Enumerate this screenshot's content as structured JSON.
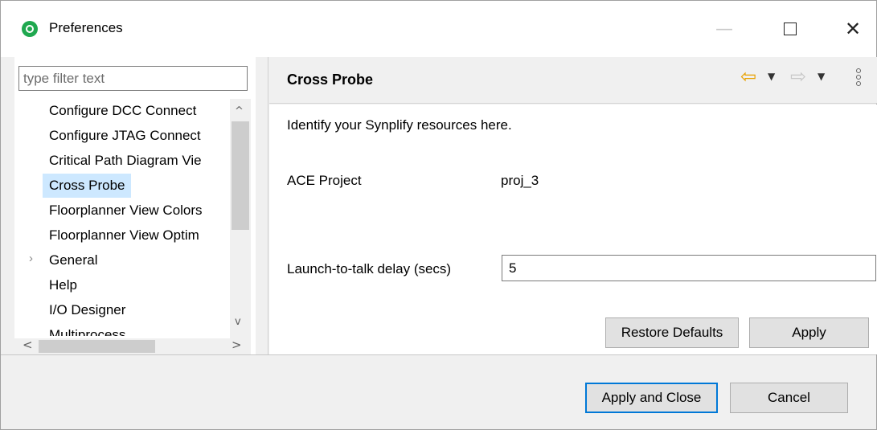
{
  "window": {
    "title": "Preferences",
    "minimize_glyph": "—",
    "close_glyph": "✕"
  },
  "sidebar": {
    "filter_placeholder": "type filter text",
    "items": [
      {
        "label": "Configure DCC Connect"
      },
      {
        "label": "Configure JTAG Connect"
      },
      {
        "label": "Critical Path Diagram Vie"
      },
      {
        "label": "Cross Probe",
        "selected": true
      },
      {
        "label": "Floorplanner View Colors"
      },
      {
        "label": "Floorplanner View Optim"
      },
      {
        "label": "General",
        "expandable": true
      },
      {
        "label": "Help"
      },
      {
        "label": "I/O Designer"
      },
      {
        "label": "Multiprocess"
      }
    ],
    "expander_glyph": "›",
    "scroll_up_glyph": "^",
    "scroll_down_glyph": "v",
    "scroll_left_glyph": "<",
    "scroll_right_glyph": ">"
  },
  "page": {
    "title": "Cross Probe",
    "nav_back_glyph": "⇦",
    "nav_forward_glyph": "⇨",
    "dropdown_glyph": "▼",
    "description": "Identify your Synplify resources here.",
    "project_label": "ACE Project",
    "project_value": "proj_3",
    "delay_label": "Launch-to-talk delay (secs)",
    "delay_value": "5",
    "restore_defaults_label": "Restore Defaults",
    "apply_label": "Apply"
  },
  "footer": {
    "apply_close_label": "Apply and Close",
    "cancel_label": "Cancel"
  },
  "colors": {
    "selection": "#cde8ff",
    "focus_border": "#0078d7",
    "nav_back": "#e8a100",
    "app_icon": "#1fa84f"
  }
}
